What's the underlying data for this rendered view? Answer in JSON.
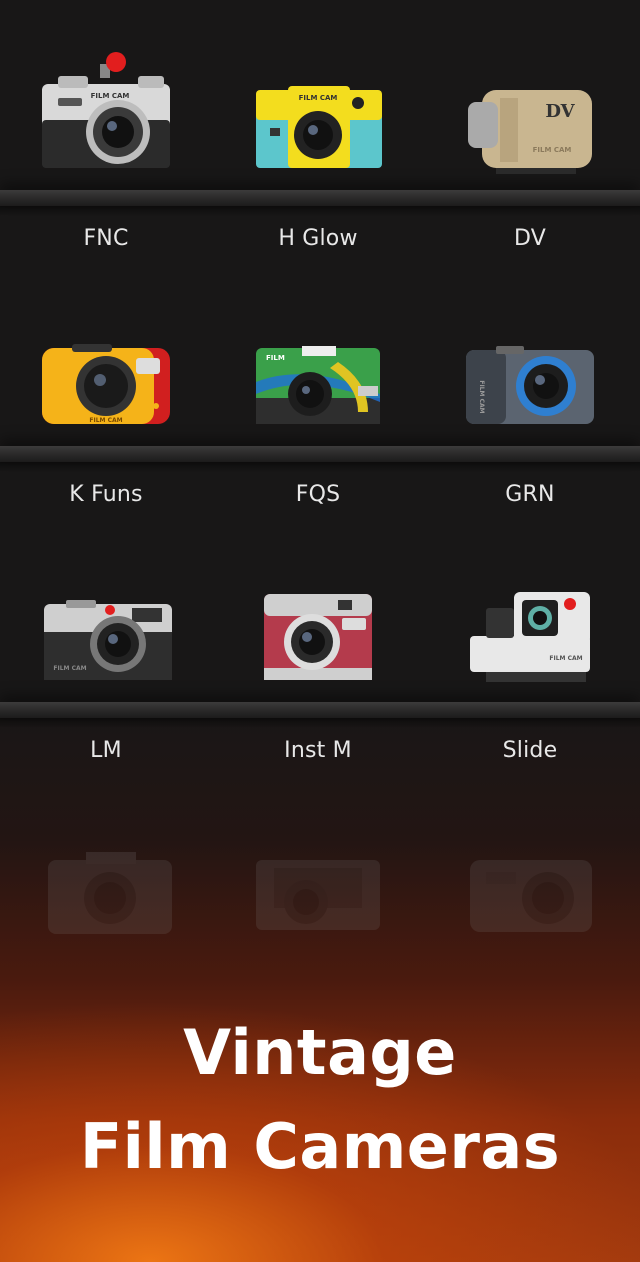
{
  "cameras": [
    {
      "name": "FNC"
    },
    {
      "name": "H Glow"
    },
    {
      "name": "DV"
    },
    {
      "name": "K Funs"
    },
    {
      "name": "FQS"
    },
    {
      "name": "GRN"
    },
    {
      "name": "LM"
    },
    {
      "name": "Inst M"
    },
    {
      "name": "Slide"
    }
  ],
  "camera_body_text": {
    "film_cam": "FILM CAM",
    "film": "FILM",
    "dv": "DV"
  },
  "headline": {
    "line1": "Vintage",
    "line2": "Film Cameras"
  },
  "colors": {
    "background": "#161515",
    "gradient_accent": "#e0781a",
    "label_text": "#e8e8e8"
  },
  "icons": [
    "fnc-camera-icon",
    "h-glow-camera-icon",
    "dv-camcorder-icon",
    "k-funs-camera-icon",
    "fqs-camera-icon",
    "grn-camera-icon",
    "lm-camera-icon",
    "inst-m-camera-icon",
    "slide-camera-icon"
  ]
}
